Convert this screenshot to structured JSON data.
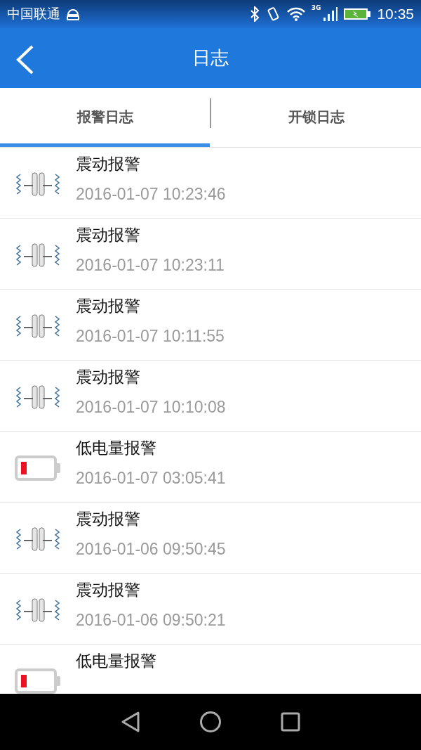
{
  "status_bar": {
    "carrier": "中国联通",
    "network": "3G",
    "time": "10:35"
  },
  "header": {
    "title": "日志"
  },
  "tabs": [
    {
      "label": "报警日志",
      "selected": true
    },
    {
      "label": "开锁日志",
      "selected": false
    }
  ],
  "logs": [
    {
      "kind": "vibration",
      "title": "震动报警",
      "time": "2016-01-07 10:23:46"
    },
    {
      "kind": "vibration",
      "title": "震动报警",
      "time": "2016-01-07 10:23:11"
    },
    {
      "kind": "vibration",
      "title": "震动报警",
      "time": "2016-01-07 10:11:55"
    },
    {
      "kind": "vibration",
      "title": "震动报警",
      "time": "2016-01-07 10:10:08"
    },
    {
      "kind": "battery",
      "title": "低电量报警",
      "time": "2016-01-07 03:05:41"
    },
    {
      "kind": "vibration",
      "title": "震动报警",
      "time": "2016-01-06 09:50:45"
    },
    {
      "kind": "vibration",
      "title": "震动报警",
      "time": "2016-01-06 09:50:21"
    },
    {
      "kind": "battery",
      "title": "低电量报警"
    }
  ]
}
